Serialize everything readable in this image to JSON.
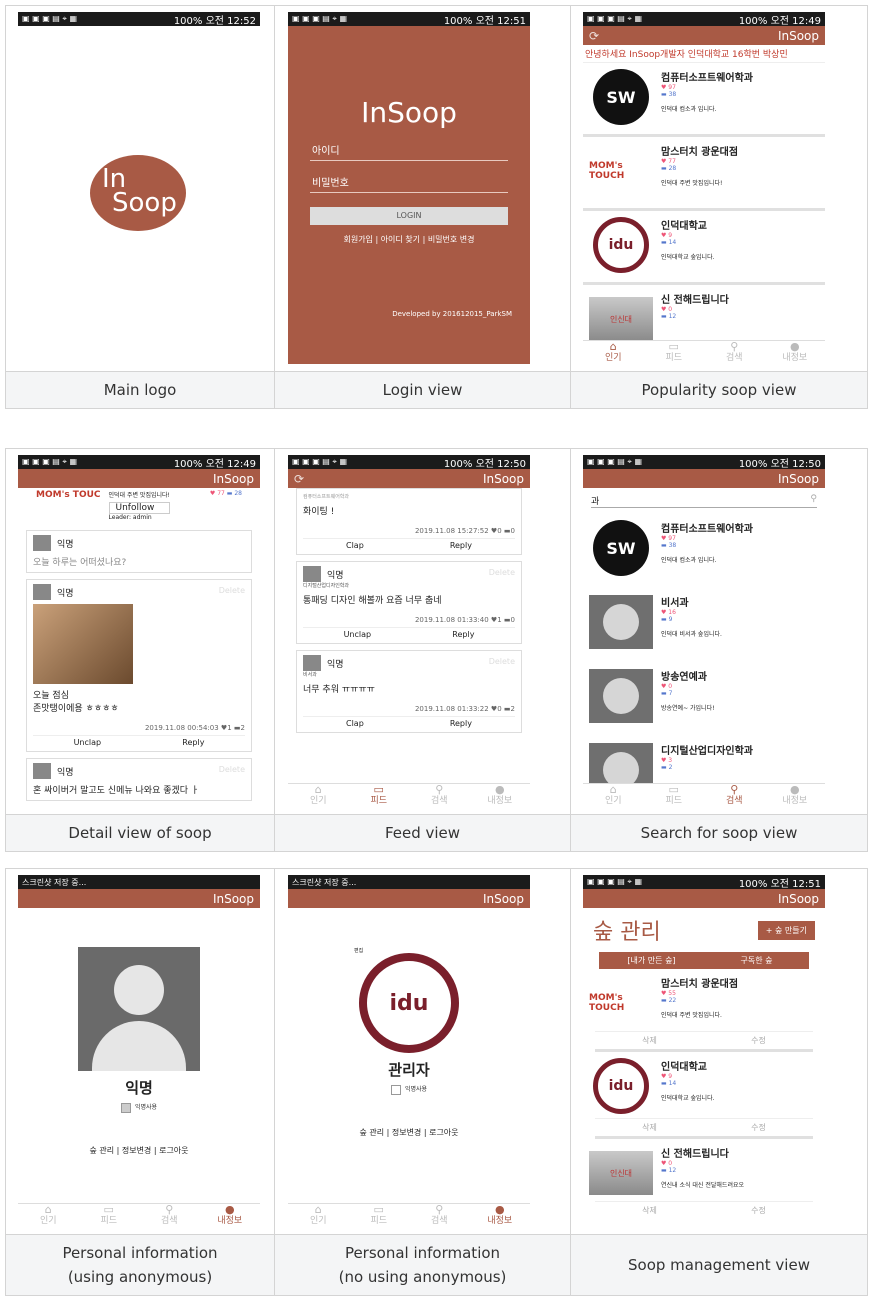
{
  "status_bar": {
    "battery": "100%",
    "t1": "오전 12:52",
    "t2": "오전 12:51",
    "t3": "오전 12:49",
    "t4": "오전 12:49",
    "t5": "오전 12:50",
    "t6": "오전 12:50",
    "t9": "오전 12:51",
    "screenshot": "스크린샷 저장 중..."
  },
  "app_title": "InSoop",
  "logo": {
    "line1": "In",
    "line2": "Soop"
  },
  "login": {
    "title": "InSoop",
    "id_placeholder": "아이디",
    "pw_placeholder": "비밀번호",
    "button": "LOGIN",
    "links": "회원가입 | 아이디 찾기 | 비밀번호 변경",
    "developer": "Developed by 201612015_ParkSM"
  },
  "ticker": "안녕하세요 InSoop개발자 인덕대학교 16학번 박상민",
  "popular": [
    {
      "title": "컴퓨터소프트웨어학과",
      "likes": "97",
      "comments": "38",
      "desc": "인덕대 컴소과 입니다.",
      "thumb": "SW"
    },
    {
      "title": "맘스터치 광운대점",
      "likes": "77",
      "comments": "28",
      "desc": "인덕대 주변 맛집입니다!",
      "thumb": "MOM's TOUCH"
    },
    {
      "title": "인덕대학교",
      "likes": "9",
      "comments": "14",
      "desc": "인덕대학교 숲입니다.",
      "thumb": "idu"
    },
    {
      "title": "신 전해드립니다",
      "likes": "0",
      "comments": "12",
      "desc": "",
      "thumb": "인신대"
    }
  ],
  "nav": [
    "인기",
    "피드",
    "검색",
    "내정보"
  ],
  "detail": {
    "header_desc": "인덕대 주변 맛집입니다!",
    "unfollow": "Unfollow",
    "leader": "Leader: admin",
    "likes": "77",
    "comments": "28",
    "write_user": "익명",
    "write_placeholder": "오늘 하루는 어떠셨나요?",
    "post1": {
      "user": "익명",
      "delete": "Delete",
      "text1": "오늘 점심",
      "text2": "존맛탱이에용 ㅎㅎㅎㅎ",
      "time": "2019.11.08 00:54:03",
      "likes": "1",
      "comments": "2",
      "clap": "Unclap",
      "reply": "Reply"
    },
    "post2": {
      "user": "익명",
      "delete": "Delete",
      "text": "혼 싸이버거 말고도 신메뉴 나와요 좋겠다 ㅏ"
    }
  },
  "feed": [
    {
      "user": "",
      "sub": "컴퓨터소프트웨어학과",
      "text": "화이팅 !",
      "time": "2019.11.08 15:27:52",
      "likes": "0",
      "comments": "0",
      "clap": "Clap",
      "reply": "Reply",
      "delete": ""
    },
    {
      "user": "익명",
      "sub": "디지털산업디자인학과",
      "text": "통패딩 디자인 해볼까 요즘 너무 춥네",
      "time": "2019.11.08 01:33:40",
      "likes": "1",
      "comments": "0",
      "clap": "Unclap",
      "reply": "Reply",
      "delete": "Delete"
    },
    {
      "user": "익명",
      "sub": "비서과",
      "text": "너무 추워 ㅠㅠㅠㅠ",
      "time": "2019.11.08 01:33:22",
      "likes": "0",
      "comments": "2",
      "clap": "Clap",
      "reply": "Reply",
      "delete": "Delete"
    }
  ],
  "search": {
    "query": "과",
    "results": [
      {
        "title": "컴퓨터소프트웨어학과",
        "likes": "97",
        "comments": "38",
        "desc": "인덕대 컴소과 입니다."
      },
      {
        "title": "비서과",
        "likes": "16",
        "comments": "9",
        "desc": "인덕대 비서과 숲입니다."
      },
      {
        "title": "방송연예과",
        "likes": "0",
        "comments": "7",
        "desc": "방송연예~ 가입니다!"
      },
      {
        "title": "디지털산업디자인학과",
        "likes": "3",
        "comments": "2",
        "desc": ""
      }
    ]
  },
  "profile_anon": {
    "name": "익명",
    "checkbox": "익명사용",
    "links": "숲 관리 | 정보변경 | 로그아웃"
  },
  "profile_admin": {
    "name": "관리자",
    "checkbox": "익명사용",
    "links": "숲 관리 | 정보변경 | 로그아웃",
    "edit": "편집"
  },
  "mgmt": {
    "title": "숲 관리",
    "add": "+ 숲 만들기",
    "tab1": "[내가 만든 숲]",
    "tab2": "구독한 숲",
    "delete": "삭제",
    "edit": "수정",
    "items": [
      {
        "title": "맘스터치 광운대점",
        "likes": "55",
        "comments": "22",
        "desc": "인덕대 주변 맛집입니다."
      },
      {
        "title": "인덕대학교",
        "likes": "9",
        "comments": "14",
        "desc": "인덕대학교 숲입니다."
      },
      {
        "title": "신 전해드립니다",
        "likes": "0",
        "comments": "12",
        "desc": "연신내 소식 대신 전달해드려요오"
      }
    ]
  },
  "captions": {
    "c1": "Main logo",
    "c2": "Login view",
    "c3": "Popularity soop view",
    "c4": "Detail view of soop",
    "c5": "Feed view",
    "c6": "Search for soop view",
    "c7a": "Personal information",
    "c7b": "(using anonymous)",
    "c8a": "Personal information",
    "c8b": "(no using anonymous)",
    "c9": "Soop management view"
  }
}
